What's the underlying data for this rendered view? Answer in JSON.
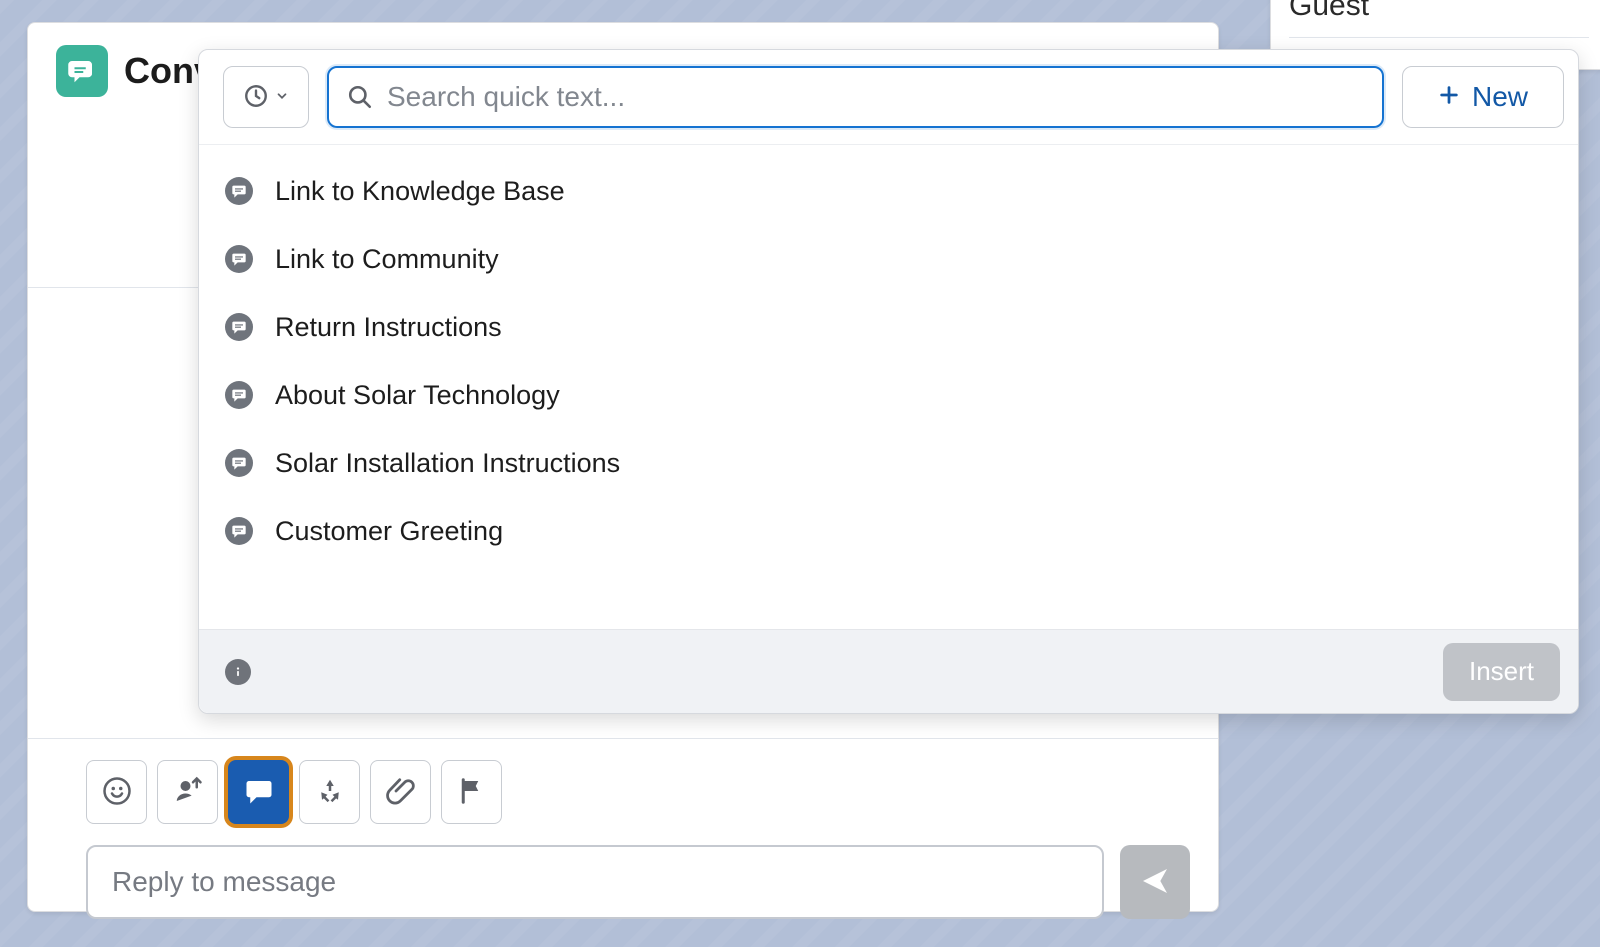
{
  "sidebar": {
    "guest_label": "Guest"
  },
  "chat": {
    "title": "Conversation",
    "reply_placeholder": "Reply to message",
    "tools": {
      "emoji": "emoji-icon",
      "transfer": "person-transfer-icon",
      "quicktext": "chat-bubble-icon",
      "repeat": "recycle-icon",
      "attachment": "paperclip-icon",
      "flag": "flag-icon"
    }
  },
  "quicktext": {
    "search_placeholder": "Search quick text...",
    "new_button": "New",
    "insert_button": "Insert",
    "items": [
      {
        "label": "Link to Knowledge Base"
      },
      {
        "label": "Link to Community"
      },
      {
        "label": "Return Instructions"
      },
      {
        "label": "About Solar Technology"
      },
      {
        "label": "Solar Installation Instructions"
      },
      {
        "label": "Customer Greeting"
      }
    ]
  }
}
